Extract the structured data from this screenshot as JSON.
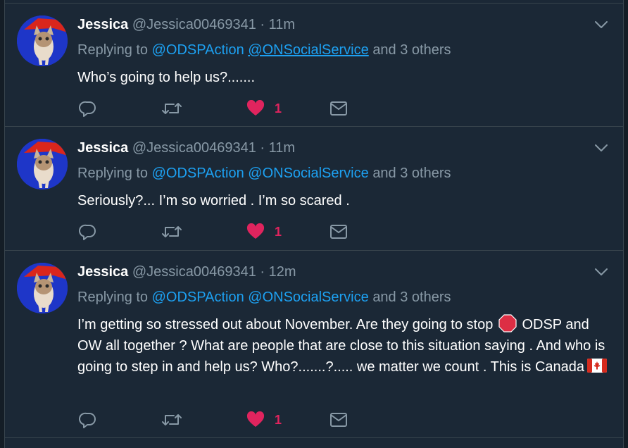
{
  "tweets": [
    {
      "name": "Jessica",
      "handle": "@Jessica00469341",
      "separator": "·",
      "time": "11m",
      "replying_prefix": "Replying to",
      "mention_1": "@ODSPAction",
      "mention_2": "@ONSocialService",
      "replying_suffix": "and 3 others",
      "text": "Who’s going to help us?.......",
      "likes": "1"
    },
    {
      "name": "Jessica",
      "handle": "@Jessica00469341",
      "separator": "·",
      "time": "11m",
      "replying_prefix": "Replying to",
      "mention_1": "@ODSPAction",
      "mention_2": "@ONSocialService",
      "replying_suffix": "and 3 others",
      "text": "Seriously?... I’m so worried . I’m so scared .",
      "likes": "1"
    },
    {
      "name": "Jessica",
      "handle": "@Jessica00469341",
      "separator": "·",
      "time": "12m",
      "replying_prefix": "Replying to",
      "mention_1": "@ODSPAction",
      "mention_2": "@ONSocialService",
      "replying_suffix": "and 3 others",
      "text_part1": "I’m getting so stressed out about November. Are they going to stop",
      "text_part2": "ODSP and OW all together ? What are people that are close to this situation saying . And who is going to step in and help us? Who?.......?..... we matter we count . This is Canada",
      "likes": "1"
    }
  ],
  "icons": {
    "reply": "reply-icon",
    "retweet": "retweet-icon",
    "like": "heart-icon",
    "dm": "envelope-icon",
    "caret": "chevron-down-icon",
    "stop": "stop-sign-emoji",
    "flag": "canada-flag-emoji"
  },
  "colors": {
    "background": "#1b2836",
    "text": "#ffffff",
    "secondary": "#8899a6",
    "link": "#1da1f2",
    "like": "#e0245e",
    "divider": "#38444d"
  }
}
